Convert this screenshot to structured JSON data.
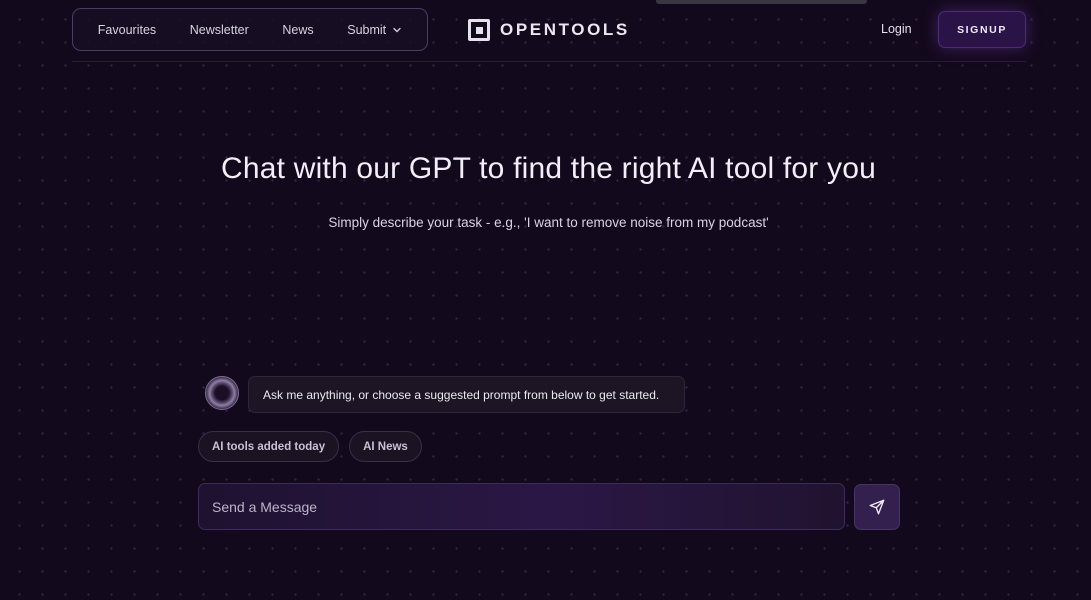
{
  "nav": {
    "items": [
      {
        "label": "Favourites"
      },
      {
        "label": "Newsletter"
      },
      {
        "label": "News"
      },
      {
        "label": "Submit",
        "icon": "chevron-down-icon"
      }
    ]
  },
  "logo": {
    "text": "OPENTOOLS",
    "icon": "opentools-logo-icon"
  },
  "auth": {
    "login_label": "Login",
    "signup_label": "SIGNUP"
  },
  "hero": {
    "title": "Chat with our GPT to find the right AI tool for you",
    "subtitle": "Simply describe your task - e.g., 'I want to remove noise from my podcast'"
  },
  "chat": {
    "bot_message": "Ask me anything, or choose a suggested prompt from below to get started.",
    "suggestions": [
      {
        "label": "AI tools added today"
      },
      {
        "label": "AI News"
      }
    ],
    "input": {
      "placeholder": "Send a Message",
      "value": ""
    },
    "send_icon": "send-icon"
  },
  "colors": {
    "background": "#13091c",
    "accent": "#2a1447",
    "text": "#f3eef8"
  }
}
